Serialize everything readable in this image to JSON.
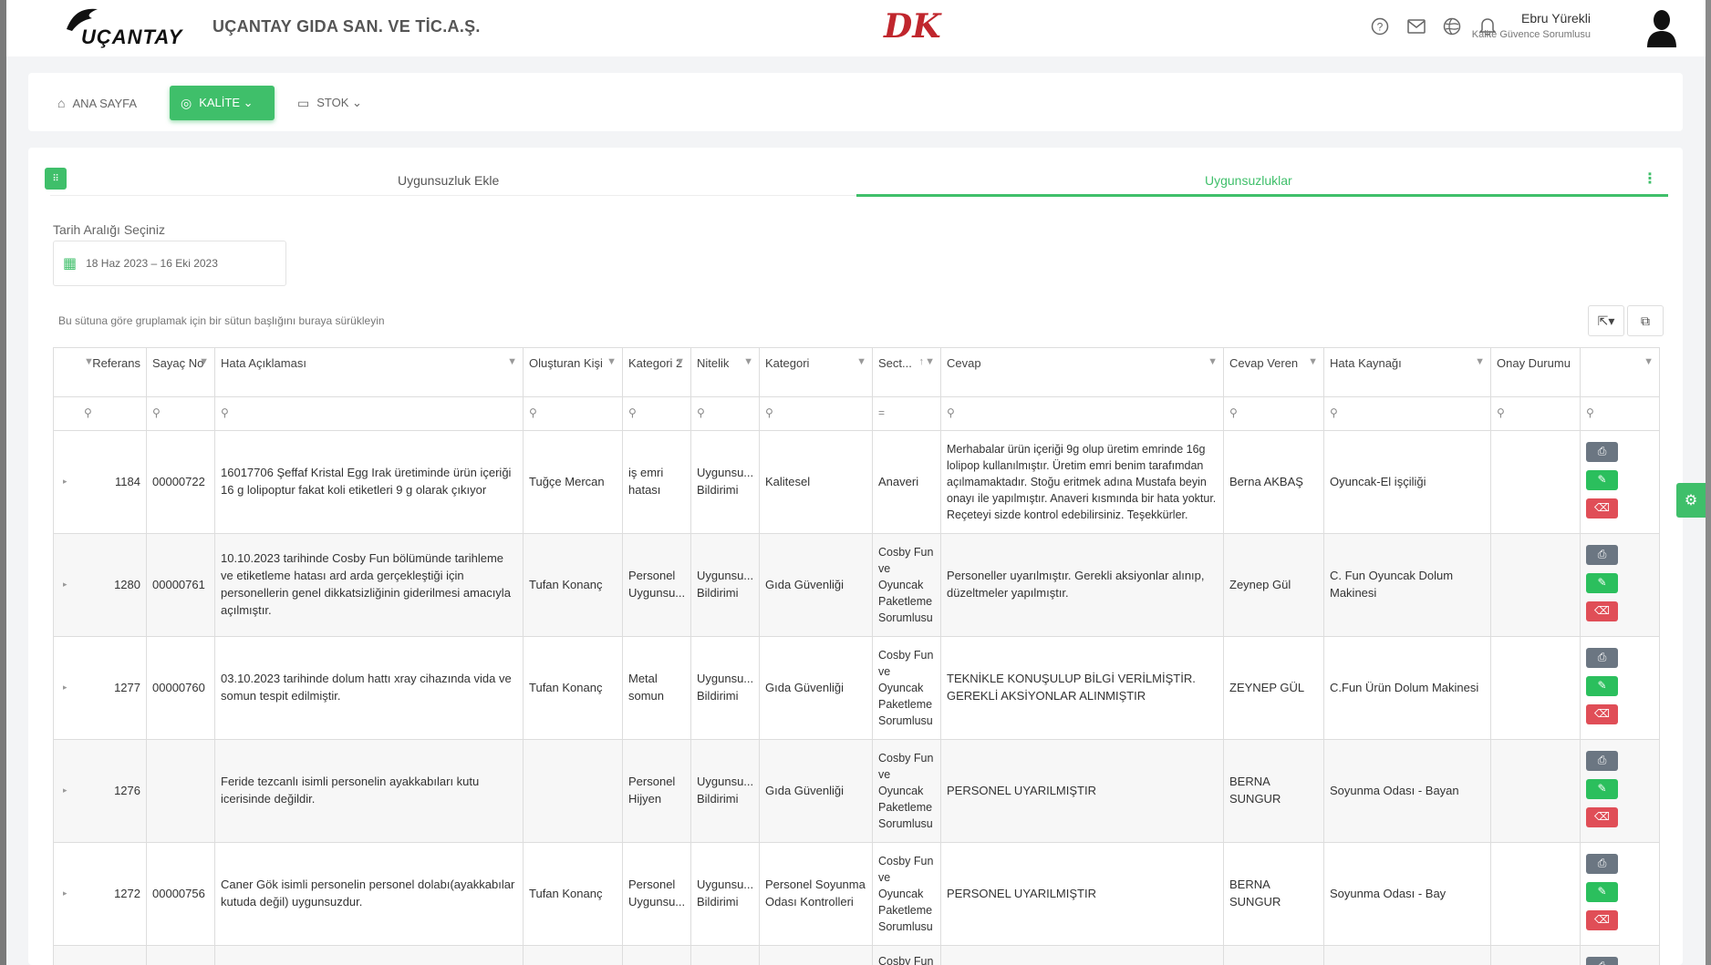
{
  "header": {
    "logo_text": "UÇANTAY",
    "company": "UÇANTAY GIDA SAN. VE TİC.A.Ş.",
    "brand_mark": "DK",
    "user_name": "Ebru Yürekli",
    "user_role": "Kalite Güvence Sorumlusu",
    "icons": [
      "help-icon",
      "mail-icon",
      "globe-icon",
      "bell-icon"
    ]
  },
  "nav": {
    "items": [
      {
        "label": "ANA SAYFA",
        "icon": "home-icon"
      },
      {
        "label": "KALİTE ⌄",
        "icon": "eye-icon",
        "active": true
      },
      {
        "label": "STOK ⌄",
        "icon": "box-icon"
      }
    ]
  },
  "tabs": [
    "Uygunsuzluk Ekle",
    "Uygunsuzluklar"
  ],
  "active_tab": "Uygunsuzluklar",
  "date_filter": {
    "label": "Tarih Aralığı Seçiniz",
    "value": "18 Haz 2023 – 16 Eki 2023"
  },
  "group_hint": "Bu sütuna göre gruplamak için bir sütun başlığını buraya sürükleyin",
  "columns": [
    "Referans",
    "Sayaç No",
    "Hata Açıklaması",
    "Oluşturan Kişi",
    "Kategori 2",
    "Nitelik",
    "Kategori",
    "Sect...",
    "Cevap",
    "Cevap Veren",
    "Hata Kaynağı",
    "Onay Durumu"
  ],
  "rows": [
    {
      "ref": "1184",
      "sayac": "00000722",
      "hata": "16017706 Şeffaf Kristal Egg Irak üretiminde ürün içeriği 16 g lolipoptur fakat koli etiketleri 9 g olarak çıkıyor",
      "olusturan": "Tuğçe Mercan",
      "kategori2": "iş emri hatası",
      "nitelik": "Uygunsu... Bildirimi",
      "kategori": "Kalitesel",
      "sect": "Anaveri",
      "cevap": "Merhabalar ürün içeriği 9g olup üretim emrinde 16g lolipop kullanılmıştır. Üretim emri benim tarafımdan açılmamaktadır. Stoğu eritmek adına Mustafa beyin onayı ile yapılmıştır. Anaveri kısmında bir hata yoktur. Reçeteyi sizde kontrol edebilirsiniz. Teşekkürler.",
      "cevap_veren": "Berna AKBAŞ",
      "kaynak": "Oyuncak-El işçiliği",
      "onay": ""
    },
    {
      "ref": "1280",
      "sayac": "00000761",
      "hata": "10.10.2023 tarihinde Cosby Fun bölümünde tarihleme ve etiketleme hatası ard arda gerçekleştiği için personellerin genel dikkatsizliğinin giderilmesi amacıyla açılmıştır.",
      "olusturan": "Tufan Konanç",
      "kategori2": "Personel Uygunsu...",
      "nitelik": "Uygunsu... Bildirimi",
      "kategori": "Gıda Güvenliği",
      "sect": "Cosby Fun ve Oyuncak Paketleme Sorumlusu",
      "cevap": "Personeller uyarılmıştır. Gerekli aksiyonlar alınıp, düzeltmeler yapılmıştır.",
      "cevap_veren": "Zeynep Gül",
      "kaynak": "C. Fun Oyuncak Dolum Makinesi",
      "onay": ""
    },
    {
      "ref": "1277",
      "sayac": "00000760",
      "hata": "03.10.2023 tarihinde dolum hattı xray cihazında vida ve somun tespit edilmiştir.",
      "olusturan": "Tufan Konanç",
      "kategori2": "Metal somun",
      "nitelik": "Uygunsu... Bildirimi",
      "kategori": "Gıda Güvenliği",
      "sect": "Cosby Fun ve Oyuncak Paketleme Sorumlusu",
      "cevap": "TEKNİKLE KONUŞULUP BİLGİ VERİLMİŞTİR. GEREKLİ AKSİYONLAR ALINMIŞTIR",
      "cevap_veren": "ZEYNEP GÜL",
      "kaynak": "C.Fun Ürün Dolum Makinesi",
      "onay": ""
    },
    {
      "ref": "1276",
      "sayac": "",
      "hata": "Feride tezcanlı isimli personelin ayakkabıları kutu icerisinde değildir.",
      "olusturan": "",
      "kategori2": "Personel Hijyen",
      "nitelik": "Uygunsu... Bildirimi",
      "kategori": "Gıda Güvenliği",
      "sect": "Cosby Fun ve Oyuncak Paketleme Sorumlusu",
      "cevap": "PERSONEL UYARILMIŞTIR",
      "cevap_veren": "BERNA SUNGUR",
      "kaynak": "Soyunma Odası - Bayan",
      "onay": ""
    },
    {
      "ref": "1272",
      "sayac": "00000756",
      "hata": "Caner Gök isimli personelin personel dolabı(ayakkabılar kutuda değil) uygunsuzdur.",
      "olusturan": "Tufan Konanç",
      "kategori2": "Personel Uygunsu...",
      "nitelik": "Uygunsu... Bildirimi",
      "kategori": "Personel Soyunma Odası Kontrolleri",
      "sect": "Cosby Fun ve Oyuncak Paketleme Sorumlusu",
      "cevap": "PERSONEL UYARILMIŞTIR",
      "cevap_veren": "BERNA SUNGUR",
      "kaynak": "Soyunma Odası - Bay",
      "onay": ""
    },
    {
      "ref": "",
      "sayac": "",
      "hata": "",
      "olusturan": "",
      "kategori2": "",
      "nitelik": "",
      "kategori": "",
      "sect": "Cosby Fun",
      "cevap": "",
      "cevap_veren": "",
      "kaynak": "",
      "onay": ""
    }
  ],
  "colors": {
    "accent": "#3fbf6a",
    "brand_red": "#c0262d",
    "print": "#6b7682",
    "edit": "#2bbf5d",
    "delete": "#e04e57"
  }
}
